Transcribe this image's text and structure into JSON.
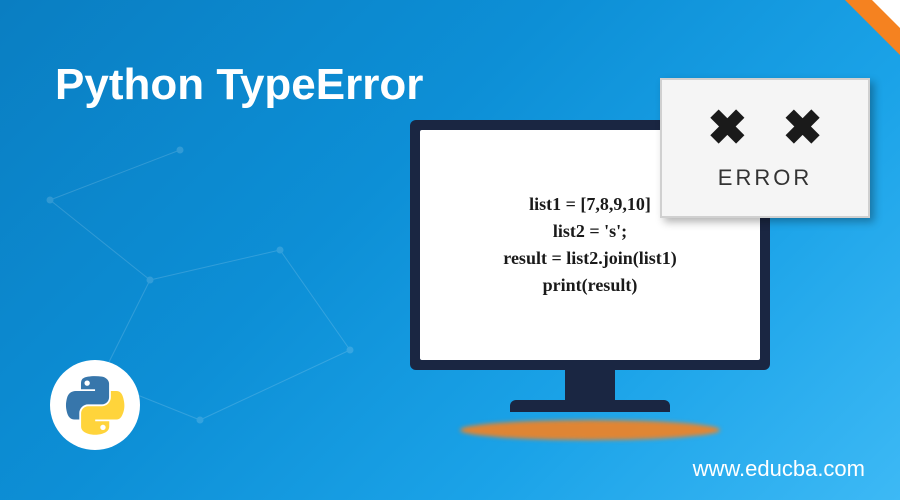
{
  "title": "Python TypeError",
  "code": {
    "line1": "list1 = [7,8,9,10]",
    "line2": "list2 = 's';",
    "line3": "result = list2.join(list1)",
    "line4": "print(result)"
  },
  "error": {
    "symbol1": "✖",
    "symbol2": "✖",
    "label": "ERROR"
  },
  "website": "www.educba.com"
}
